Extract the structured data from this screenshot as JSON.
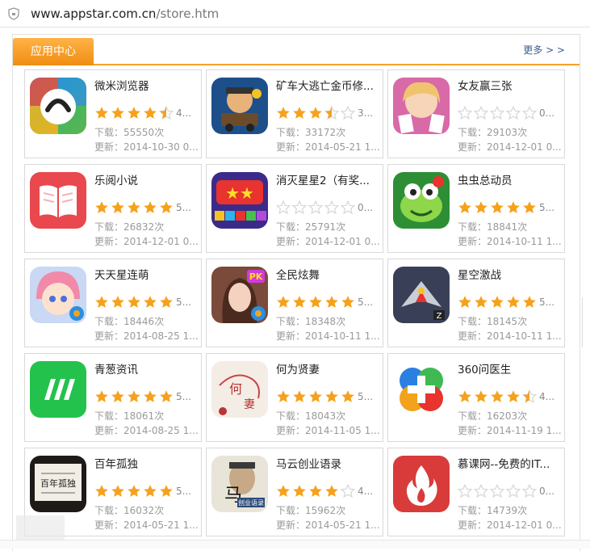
{
  "browser": {
    "url_host": "www.appstar.com.cn",
    "url_path": "/store.htm"
  },
  "section": {
    "title": "应用中心",
    "more_label": "更多 > >",
    "accent_color": "#f6a22a"
  },
  "download_prefix": "下载：",
  "update_prefix": "更新：",
  "apps": [
    {
      "name": "微米浏览器",
      "rating": 4.5,
      "score": "4...",
      "downloads": "55550次",
      "updated": "2014-10-30 0...",
      "icon": "weimi-browser-icon"
    },
    {
      "name": "矿车大逃亡金币修...",
      "rating": 3.5,
      "score": "3...",
      "downloads": "33172次",
      "updated": "2014-05-21 1...",
      "icon": "mine-cart-game-icon"
    },
    {
      "name": "女友赢三张",
      "rating": 0,
      "score": "0...",
      "downloads": "29103次",
      "updated": "2014-12-01 0...",
      "icon": "anime-girl-cards-icon"
    },
    {
      "name": "乐阅小说",
      "rating": 5,
      "score": "5...",
      "downloads": "26832次",
      "updated": "2014-12-01 0...",
      "icon": "open-book-icon"
    },
    {
      "name": "消灭星星2（有奖...",
      "rating": 0,
      "score": "0...",
      "downloads": "25791次",
      "updated": "2014-12-01 0...",
      "icon": "popstar-game-icon"
    },
    {
      "name": "虫虫总动员",
      "rating": 5,
      "score": "5...",
      "downloads": "18841次",
      "updated": "2014-10-11 1...",
      "icon": "green-frog-icon"
    },
    {
      "name": "天天星连萌",
      "rating": 5,
      "score": "5...",
      "downloads": "18446次",
      "updated": "2014-08-25 1...",
      "icon": "anime-star-girl-icon"
    },
    {
      "name": "全民炫舞",
      "rating": 5,
      "score": "5...",
      "downloads": "18348次",
      "updated": "2014-10-11 1...",
      "icon": "dance-girl-pk-icon"
    },
    {
      "name": "星空激战",
      "rating": 5,
      "score": "5...",
      "downloads": "18145次",
      "updated": "2014-10-11 1...",
      "icon": "space-fighter-icon"
    },
    {
      "name": "青葱资讯",
      "rating": 5,
      "score": "5...",
      "downloads": "18061次",
      "updated": "2014-08-25 1...",
      "icon": "green-news-icon"
    },
    {
      "name": "何为贤妻",
      "rating": 5,
      "score": "5...",
      "downloads": "18043次",
      "updated": "2014-11-05 1...",
      "icon": "novel-cover-icon"
    },
    {
      "name": "360问医生",
      "rating": 4.5,
      "score": "4...",
      "downloads": "16203次",
      "updated": "2014-11-19 1...",
      "icon": "medical-cross-icon"
    },
    {
      "name": "百年孤独",
      "rating": 5,
      "score": "5...",
      "downloads": "16032次",
      "updated": "2014-05-21 1...",
      "icon": "dark-book-cover-icon"
    },
    {
      "name": "马云创业语录",
      "rating": 4,
      "score": "4...",
      "downloads": "15962次",
      "updated": "2014-05-21 1...",
      "icon": "jack-ma-book-icon"
    },
    {
      "name": "慕课网--免费的IT...",
      "rating": 0,
      "score": "0...",
      "downloads": "14739次",
      "updated": "2014-12-01 0...",
      "icon": "red-flame-icon"
    }
  ],
  "colors": {
    "star_filled": "#f6a11b",
    "star_empty": "#d6d6d6",
    "link": "#3a5c8c"
  }
}
